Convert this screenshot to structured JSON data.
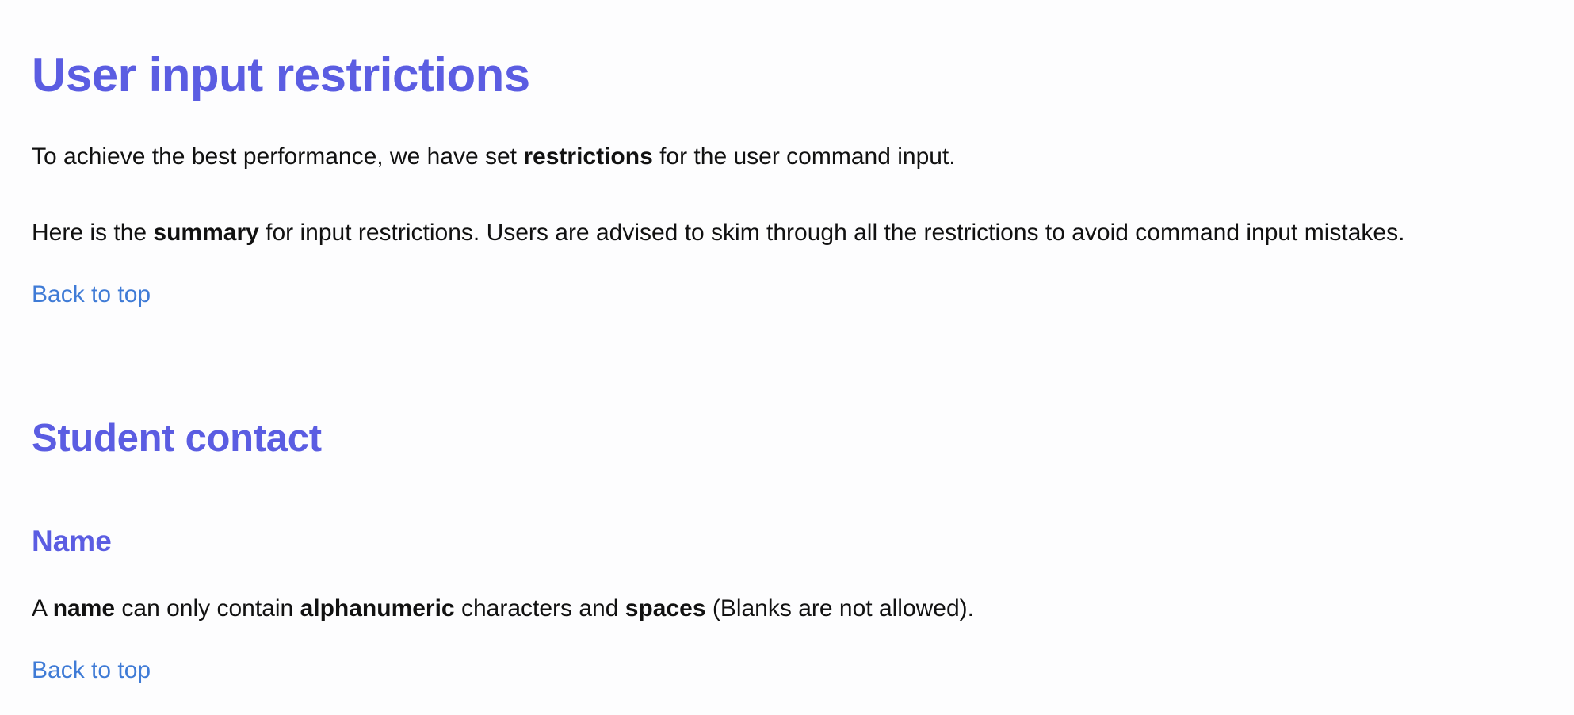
{
  "intro": {
    "title": "User input restrictions",
    "paragraph1": {
      "part1": "To achieve the best performance, we have set ",
      "bold1": "restrictions",
      "part2": " for the user command input."
    },
    "paragraph2": {
      "part1": "Here is the ",
      "bold1": "summary",
      "part2": " for input restrictions. Users are advised to skim through all the restrictions to avoid command input mistakes."
    },
    "back_to_top": "Back to top"
  },
  "student_contact": {
    "title": "Student contact",
    "name_section": {
      "title": "Name",
      "paragraph": {
        "part1": "A ",
        "bold1": "name",
        "part2": " can only contain ",
        "bold2": "alphanumeric",
        "part3": " characters and ",
        "bold3": "spaces",
        "part4": " (Blanks are not allowed)."
      },
      "back_to_top": "Back to top"
    }
  },
  "colors": {
    "heading": "#5b5de2",
    "link": "#3f7bd6",
    "text": "#111111",
    "background": "#fdfdfe"
  }
}
